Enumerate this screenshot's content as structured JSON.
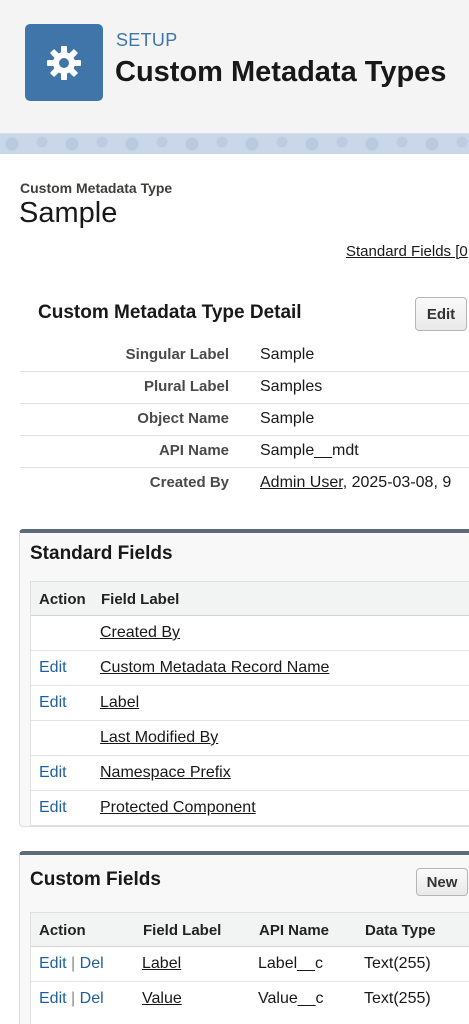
{
  "header": {
    "section_label": "SETUP",
    "page_title": "Custom Metadata Types",
    "icon": "gear-icon",
    "icon_color": "#3f75a8"
  },
  "record": {
    "kind_label": "Custom Metadata Type",
    "name": "Sample",
    "standard_fields_link": "Standard Fields [0"
  },
  "detail": {
    "title": "Custom Metadata Type Detail",
    "edit_label": "Edit",
    "rows": [
      {
        "label": "Singular Label",
        "value": "Sample"
      },
      {
        "label": "Plural Label",
        "value": "Samples"
      },
      {
        "label": "Object Name",
        "value": "Sample"
      },
      {
        "label": "API Name",
        "value": "Sample__mdt"
      }
    ],
    "created_by": {
      "label": "Created By",
      "user": "Admin User",
      "timestamp": ", 2025-03-08, 9"
    }
  },
  "standard_fields": {
    "title": "Standard Fields",
    "columns": {
      "action": "Action",
      "field_label": "Field Label"
    },
    "rows": [
      {
        "action": "",
        "field_label": "Created By"
      },
      {
        "action": "Edit",
        "field_label": "Custom Metadata Record Name"
      },
      {
        "action": "Edit",
        "field_label": "Label"
      },
      {
        "action": "",
        "field_label": "Last Modified By"
      },
      {
        "action": "Edit",
        "field_label": "Namespace Prefix"
      },
      {
        "action": "Edit",
        "field_label": "Protected Component"
      }
    ]
  },
  "custom_fields": {
    "title": "Custom Fields",
    "new_label": "New",
    "columns": {
      "action": "Action",
      "field_label": "Field Label",
      "api_name": "API Name",
      "data_type": "Data Type"
    },
    "separator": "|",
    "rows": [
      {
        "edit": "Edit",
        "del": "Del",
        "field_label": "Label",
        "api_name": "Label__c",
        "data_type": "Text(255)"
      },
      {
        "edit": "Edit",
        "del": "Del",
        "field_label": "Value",
        "api_name": "Value__c",
        "data_type": "Text(255)"
      }
    ]
  }
}
